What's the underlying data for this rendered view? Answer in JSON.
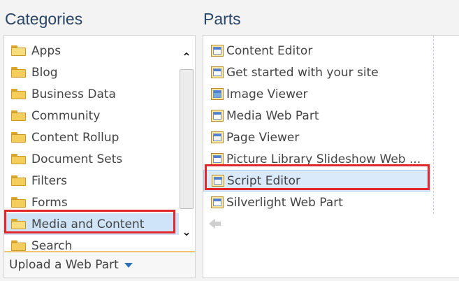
{
  "headings": {
    "categories": "Categories",
    "parts": "Parts"
  },
  "categories": {
    "items": [
      {
        "label": "Apps",
        "icon": "folder-icon"
      },
      {
        "label": "Blog",
        "icon": "folder-icon"
      },
      {
        "label": "Business Data",
        "icon": "folder-icon"
      },
      {
        "label": "Community",
        "icon": "folder-icon"
      },
      {
        "label": "Content Rollup",
        "icon": "folder-icon"
      },
      {
        "label": "Document Sets",
        "icon": "folder-icon"
      },
      {
        "label": "Filters",
        "icon": "folder-icon"
      },
      {
        "label": "Forms",
        "icon": "folder-icon"
      },
      {
        "label": "Media and Content",
        "icon": "open-folder-icon",
        "selected": true
      },
      {
        "label": "Search",
        "icon": "folder-icon"
      }
    ],
    "upload_label": "Upload a Web Part"
  },
  "parts": {
    "items": [
      {
        "label": "Content Editor",
        "icon": "web-part-icon"
      },
      {
        "label": "Get started with your site",
        "icon": "web-part-icon"
      },
      {
        "label": "Image Viewer",
        "icon": "image-icon"
      },
      {
        "label": "Media Web Part",
        "icon": "web-part-icon"
      },
      {
        "label": "Page Viewer",
        "icon": "page-icon"
      },
      {
        "label": "Picture Library Slideshow Web ...",
        "icon": "web-part-icon"
      },
      {
        "label": "Script Editor",
        "icon": "web-part-icon",
        "selected": true
      },
      {
        "label": "Silverlight Web Part",
        "icon": "web-part-icon"
      }
    ]
  },
  "colors": {
    "heading": "#2a4566",
    "selected_bg": "#cfe4f8",
    "highlight_border": "#e1262c",
    "accent_arrow": "#2f6fb5"
  }
}
